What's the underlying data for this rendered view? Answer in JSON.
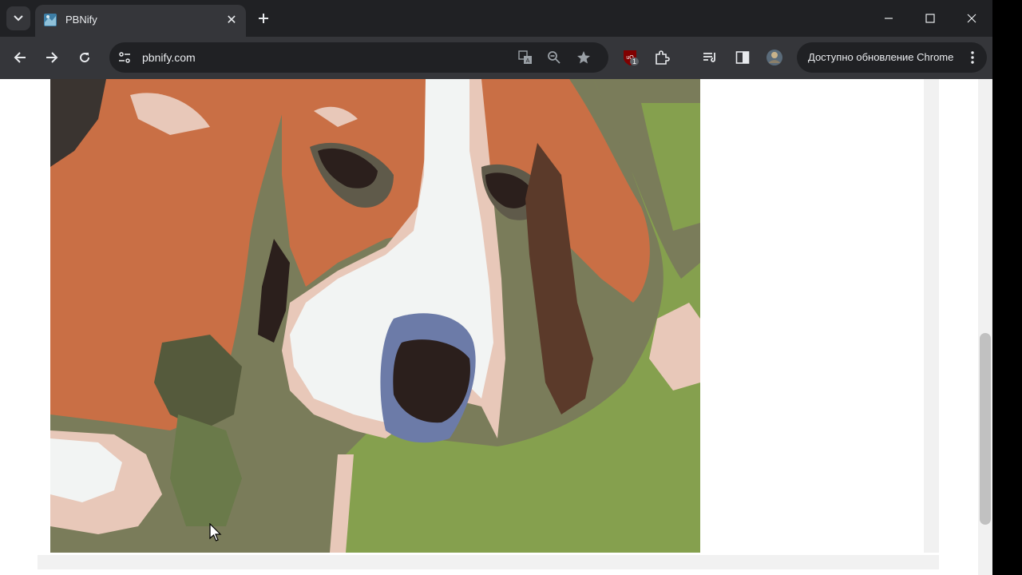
{
  "tab": {
    "title": "PBNify",
    "close_glyph": "✕"
  },
  "omnibox": {
    "url": "pbnify.com"
  },
  "update_button": {
    "label": "Доступно обновление Chrome"
  },
  "extension_badge": {
    "count": "1"
  },
  "colors": {
    "tabstrip": "#202124",
    "toolbar": "#35363a",
    "text": "#e8eaed",
    "painting_orange": "#c96f45",
    "painting_green": "#85a04e",
    "painting_white": "#f2f4f3",
    "painting_pink": "#e8c8b9",
    "painting_olive": "#7a7c5a",
    "painting_dark": "#2b1f1c"
  },
  "icons": [
    "tab-search-icon",
    "pbnify-favicon",
    "close-icon",
    "plus-icon",
    "minimize-icon",
    "maximize-icon",
    "window-close-icon",
    "back-icon",
    "forward-icon",
    "reload-icon",
    "site-info-icon",
    "translate-icon",
    "zoom-icon",
    "star-icon",
    "ublock-icon",
    "extensions-icon",
    "media-icon",
    "side-panel-icon",
    "profile-avatar",
    "more-vert-icon",
    "mouse-cursor-icon"
  ]
}
